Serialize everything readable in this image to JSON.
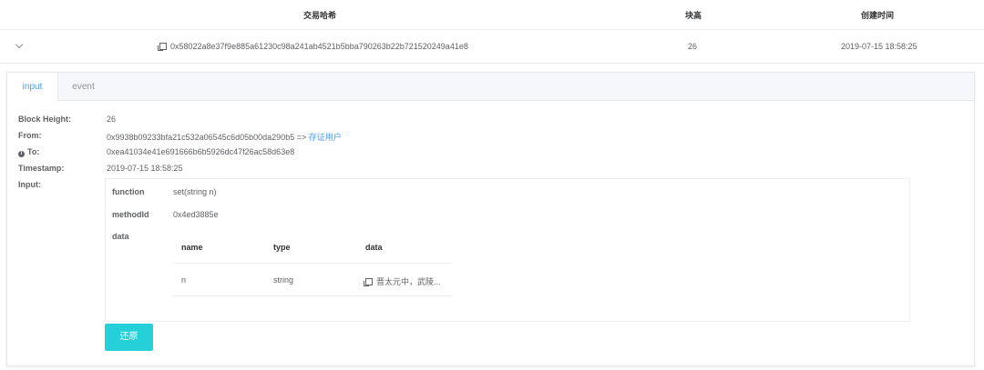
{
  "table": {
    "headers": {
      "hash": "交易哈希",
      "height": "块高",
      "created": "创建时间"
    },
    "row": {
      "hash": "0x58022a8e37f9e885a61230c98a241ab4521b5bba790263b22b721520249a41e8",
      "height": "26",
      "created": "2019-07-15 18:58:25"
    }
  },
  "tabs": {
    "input": "input",
    "event": "event"
  },
  "details": {
    "block_height_label": "Block Height:",
    "block_height": "26",
    "from_label": "From:",
    "from_value": "0x9938b09233bfa21c532a06545c6d05b00da290b5 =>",
    "from_link": "存证用户",
    "to_label": "To:",
    "to_value": "0xea41034e41e691666b6b5926dc47f26ac58d63e8",
    "timestamp_label": "Timestamp:",
    "timestamp": "2019-07-15 18:58:25",
    "input_label": "Input:"
  },
  "input": {
    "function_label": "function",
    "function_value": "set(string n)",
    "methodid_label": "methodId",
    "methodid_value": "0x4ed3885e",
    "data_label": "data",
    "data_table": {
      "headers": [
        "name",
        "type",
        "data"
      ],
      "rows": [
        {
          "name": "n",
          "type": "string",
          "data": "晋太元中，武陵..."
        }
      ]
    }
  },
  "restore_button": "还原"
}
